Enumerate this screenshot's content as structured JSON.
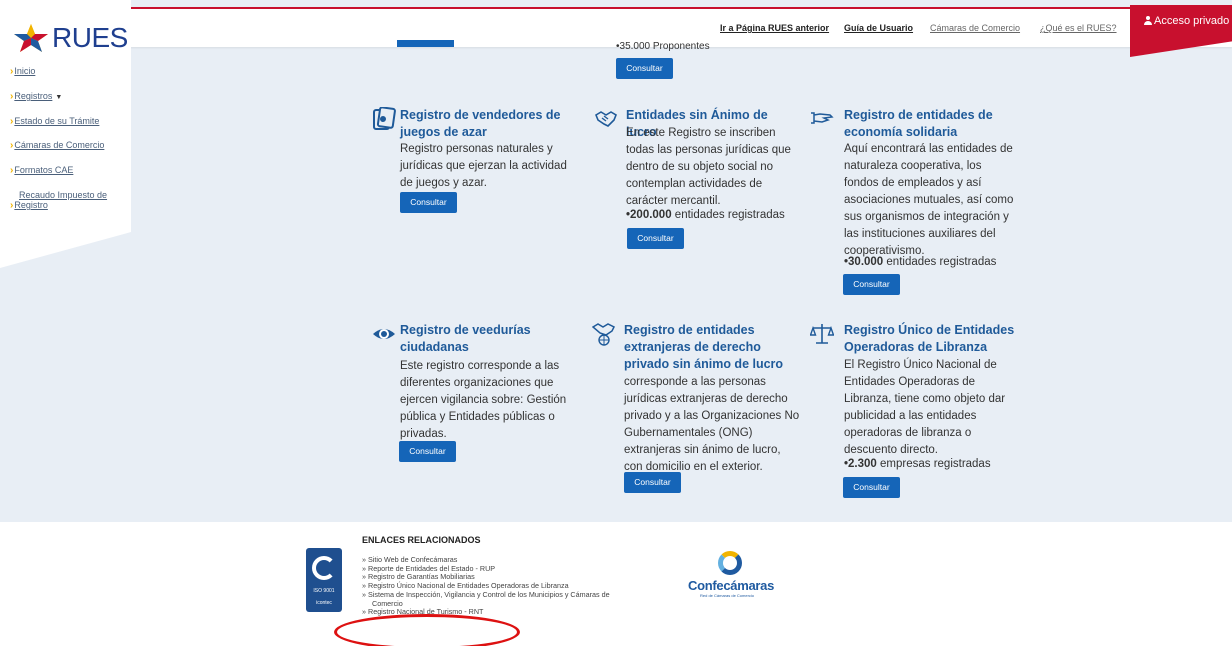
{
  "brand": {
    "logo_text": "RUES",
    "accent": "#c8102e",
    "primary": "#1565b8",
    "title_color": "#1f5a99",
    "background": "#e8eef5"
  },
  "topnav": {
    "ir_pagina": "Ir a Página RUES anterior",
    "guia": "Guía de Usuario",
    "camaras": "Cámaras de Comercio",
    "que_es": "¿Qué es el RUES?",
    "acceso": "Acceso privado"
  },
  "sidebar": {
    "items": [
      {
        "label": "Inicio"
      },
      {
        "label": "Registros"
      },
      {
        "label": "Estado de su Trámite"
      },
      {
        "label": "Cámaras de Comercio"
      },
      {
        "label": "Formatos CAE"
      },
      {
        "label_line1": "Recaudo Impuesto de",
        "label_line2": "Registro"
      }
    ]
  },
  "top_partial": {
    "stat_text": "•35.000 Proponentes",
    "button": "Consultar"
  },
  "cards": [
    {
      "icon": "cards-icon",
      "title_lines": [
        "Registro de vendedores de",
        "juegos de azar"
      ],
      "desc_lines": [
        "Registro personas naturales y",
        "jurídicas que ejerzan la actividad",
        "de juegos y azar."
      ],
      "stat_num": "",
      "stat_text": "",
      "button": "Consultar"
    },
    {
      "icon": "handshake-icon",
      "title_lines": [
        "Entidades sin Ánimo de lucro"
      ],
      "desc_lines": [
        "En este Registro se inscriben",
        "todas las personas jurídicas que",
        "dentro de su objeto social no",
        "contemplan actividades de",
        "carácter mercantil."
      ],
      "stat_num": "•200.000",
      "stat_text": " entidades registradas",
      "button": "Consultar"
    },
    {
      "icon": "hand-icon",
      "title_lines": [
        "Registro de entidades de",
        "economía solidaria"
      ],
      "desc_lines": [
        "Aquí encontrará las entidades de",
        "naturaleza cooperativa, los",
        "fondos de empleados y así",
        "asociaciones mutuales, así como",
        "sus organismos de integración y",
        "las instituciones auxiliares del",
        "cooperativismo."
      ],
      "stat_num": "•30.000",
      "stat_text": " entidades registradas",
      "button": "Consultar"
    },
    {
      "icon": "eye-icon",
      "title_lines": [
        "Registro de veedurías",
        "ciudadanas"
      ],
      "desc_lines": [
        "Este registro corresponde a las",
        "diferentes organizaciones que",
        "ejercen vigilancia sobre: Gestión",
        "pública y Entidades públicas o",
        "privadas."
      ],
      "stat_num": "",
      "stat_text": "",
      "button": "Consultar"
    },
    {
      "icon": "globe-handshake-icon",
      "title_lines": [
        "Registro de entidades",
        "extranjeras de derecho",
        "privado sin ánimo de lucro"
      ],
      "desc_lines": [
        "corresponde a las personas",
        "jurídicas extranjeras de derecho",
        "privado y a las Organizaciones No",
        "Gubernamentales (ONG)",
        "extranjeras sin ánimo de lucro,",
        "con domicilio en el exterior."
      ],
      "stat_num": "",
      "stat_text": "",
      "button": "Consultar"
    },
    {
      "icon": "scale-icon",
      "title_lines": [
        "Registro Único de Entidades",
        "Operadoras de Libranza"
      ],
      "desc_lines": [
        "El Registro Único Nacional de",
        "Entidades Operadoras de",
        "Libranza, tiene como objeto dar",
        "publicidad a las entidades",
        "operadoras de libranza o",
        "descuento directo."
      ],
      "stat_num": "•2.300",
      "stat_text": " empresas registradas",
      "button": "Consultar"
    }
  ],
  "footer": {
    "title": "ENLACES RELACIONADOS",
    "links": [
      "Sitio Web de Confecámaras",
      "Reporte de Entidades del Estado - RUP",
      "Registro de Garantías Mobiliarias",
      "Registro Único Nacional de Entidades Operadoras de Libranza",
      "Sistema de Inspección, Vigilancia y Control de los Municipios y Cámaras de",
      "Comercio",
      "Registro Nacional de Turismo - RNT"
    ],
    "iso_label": "ISO 9001",
    "iso_sub": "icontec",
    "confecamaras": "Confecámaras",
    "confecamaras_sub": "Red de Cámaras de Comercio"
  }
}
